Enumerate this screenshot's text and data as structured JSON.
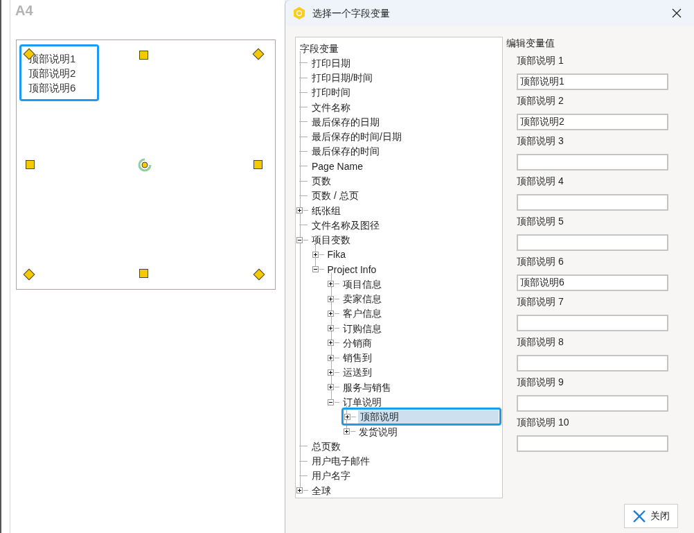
{
  "canvas": {
    "page_label": "A4",
    "text_box": [
      "顶部说明1",
      "顶部说明2",
      "顶部说明6"
    ]
  },
  "dialog": {
    "title": "选择一个字段变量",
    "tree": {
      "label": "字段变量",
      "kind": "root",
      "children": [
        {
          "label": "打印日期",
          "kind": "leaf",
          "selected": false
        },
        {
          "label": "打印日期/时间",
          "kind": "leaf",
          "selected": false
        },
        {
          "label": "打印时间",
          "kind": "leaf",
          "selected": false
        },
        {
          "label": "文件名称",
          "kind": "leaf",
          "selected": false
        },
        {
          "label": "最后保存的日期",
          "kind": "leaf",
          "selected": false
        },
        {
          "label": "最后保存的时间/日期",
          "kind": "leaf",
          "selected": false
        },
        {
          "label": "最后保存的时间",
          "kind": "leaf",
          "selected": false
        },
        {
          "label": "Page Name",
          "kind": "leaf",
          "selected": false
        },
        {
          "label": "页数",
          "kind": "leaf",
          "selected": false
        },
        {
          "label": "页数 / 总页",
          "kind": "leaf",
          "selected": false
        },
        {
          "label": "纸张组",
          "kind": "folder",
          "expanded": false,
          "selected": false
        },
        {
          "label": "文件名称及图径",
          "kind": "leaf",
          "selected": false
        },
        {
          "label": "项目变数",
          "kind": "folder",
          "expanded": true,
          "selected": false,
          "children": [
            {
              "label": "Fika",
              "kind": "folder",
              "expanded": false,
              "selected": false
            },
            {
              "label": "Project Info",
              "kind": "folder",
              "expanded": true,
              "selected": false,
              "children": [
                {
                  "label": "项目信息",
                  "kind": "folder",
                  "expanded": false,
                  "selected": false
                },
                {
                  "label": "卖家信息",
                  "kind": "folder",
                  "expanded": false,
                  "selected": false
                },
                {
                  "label": "客户信息",
                  "kind": "folder",
                  "expanded": false,
                  "selected": false
                },
                {
                  "label": "订购信息",
                  "kind": "folder",
                  "expanded": false,
                  "selected": false
                },
                {
                  "label": "分销商",
                  "kind": "folder",
                  "expanded": false,
                  "selected": false
                },
                {
                  "label": "销售到",
                  "kind": "folder",
                  "expanded": false,
                  "selected": false
                },
                {
                  "label": "运送到",
                  "kind": "folder",
                  "expanded": false,
                  "selected": false
                },
                {
                  "label": "服务与销售",
                  "kind": "folder",
                  "expanded": false,
                  "selected": false
                },
                {
                  "label": "订单说明",
                  "kind": "folder",
                  "expanded": true,
                  "selected": false,
                  "children": [
                    {
                      "label": "顶部说明",
                      "kind": "folder",
                      "expanded": false,
                      "selected": true
                    },
                    {
                      "label": "发货说明",
                      "kind": "folder",
                      "expanded": false,
                      "selected": false
                    }
                  ]
                }
              ]
            }
          ]
        },
        {
          "label": "总页数",
          "kind": "leaf",
          "selected": false
        },
        {
          "label": "用户电子邮件",
          "kind": "leaf",
          "selected": false
        },
        {
          "label": "用户名字",
          "kind": "leaf",
          "selected": false
        },
        {
          "label": "全球",
          "kind": "folder",
          "expanded": false,
          "selected": false
        }
      ]
    },
    "edit_heading": "编辑变量值",
    "fields": [
      {
        "label": "顶部说明 1",
        "value": "顶部说明1"
      },
      {
        "label": "顶部说明 2",
        "value": "顶部说明2"
      },
      {
        "label": "顶部说明 3"
      },
      {
        "label": "顶部说明 4"
      },
      {
        "label": "顶部说明 5"
      },
      {
        "label": "顶部说明 6",
        "value": "顶部说明6"
      },
      {
        "label": "顶部说明 7"
      },
      {
        "label": "顶部说明 8"
      },
      {
        "label": "顶部说明 9"
      },
      {
        "label": "顶部说明 10"
      }
    ],
    "close_button": "关闭"
  }
}
